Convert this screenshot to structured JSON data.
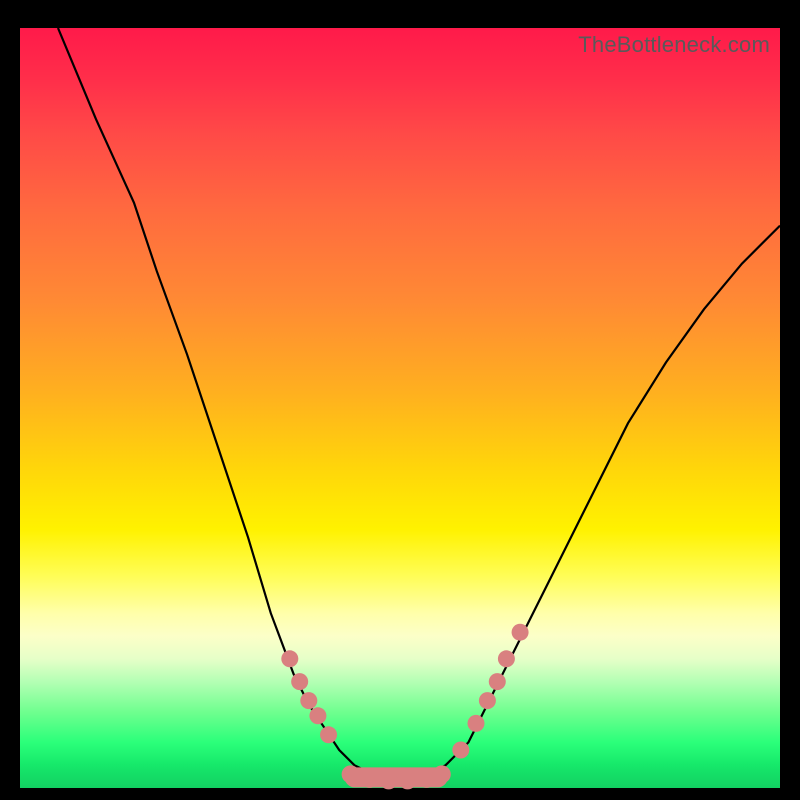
{
  "watermark": "TheBottleneck.com",
  "colors": {
    "gradient_top": "#ff1a4a",
    "gradient_mid": "#ffd60a",
    "gradient_bottom": "#12d062",
    "curve": "#000000",
    "marker": "#d98080",
    "frame": "#000000"
  },
  "chart_data": {
    "type": "line",
    "title": "",
    "xlabel": "",
    "ylabel": "",
    "xlim": [
      0,
      100
    ],
    "ylim": [
      0,
      100
    ],
    "grid": false,
    "curve_points_xy": [
      [
        5,
        100
      ],
      [
        10,
        88
      ],
      [
        15,
        77
      ],
      [
        18,
        68
      ],
      [
        22,
        57
      ],
      [
        26,
        45
      ],
      [
        30,
        33
      ],
      [
        33,
        23
      ],
      [
        36,
        15
      ],
      [
        38,
        11
      ],
      [
        40,
        8
      ],
      [
        42,
        5
      ],
      [
        44,
        3
      ],
      [
        47,
        1.5
      ],
      [
        50,
        1
      ],
      [
        53,
        1.5
      ],
      [
        56,
        3
      ],
      [
        59,
        6
      ],
      [
        62,
        12
      ],
      [
        66,
        20
      ],
      [
        70,
        28
      ],
      [
        75,
        38
      ],
      [
        80,
        48
      ],
      [
        85,
        56
      ],
      [
        90,
        63
      ],
      [
        95,
        69
      ],
      [
        100,
        74
      ]
    ],
    "left_arm_markers_xy": [
      [
        35.5,
        17
      ],
      [
        36.8,
        14
      ],
      [
        38.0,
        11.5
      ],
      [
        39.2,
        9.5
      ],
      [
        40.6,
        7.0
      ]
    ],
    "right_arm_markers_xy": [
      [
        58.0,
        5.0
      ],
      [
        60.0,
        8.5
      ],
      [
        61.5,
        11.5
      ],
      [
        62.8,
        14.0
      ],
      [
        64.0,
        17.0
      ],
      [
        65.8,
        20.5
      ]
    ],
    "bottom_flat_markers_xy": [
      [
        43.5,
        1.8
      ],
      [
        46.0,
        1.2
      ],
      [
        48.5,
        1.0
      ],
      [
        51.0,
        1.0
      ],
      [
        53.5,
        1.2
      ],
      [
        55.5,
        1.8
      ]
    ],
    "bottom_pill_xy": [
      43.5,
      1.4,
      55.5,
      1.4
    ]
  }
}
